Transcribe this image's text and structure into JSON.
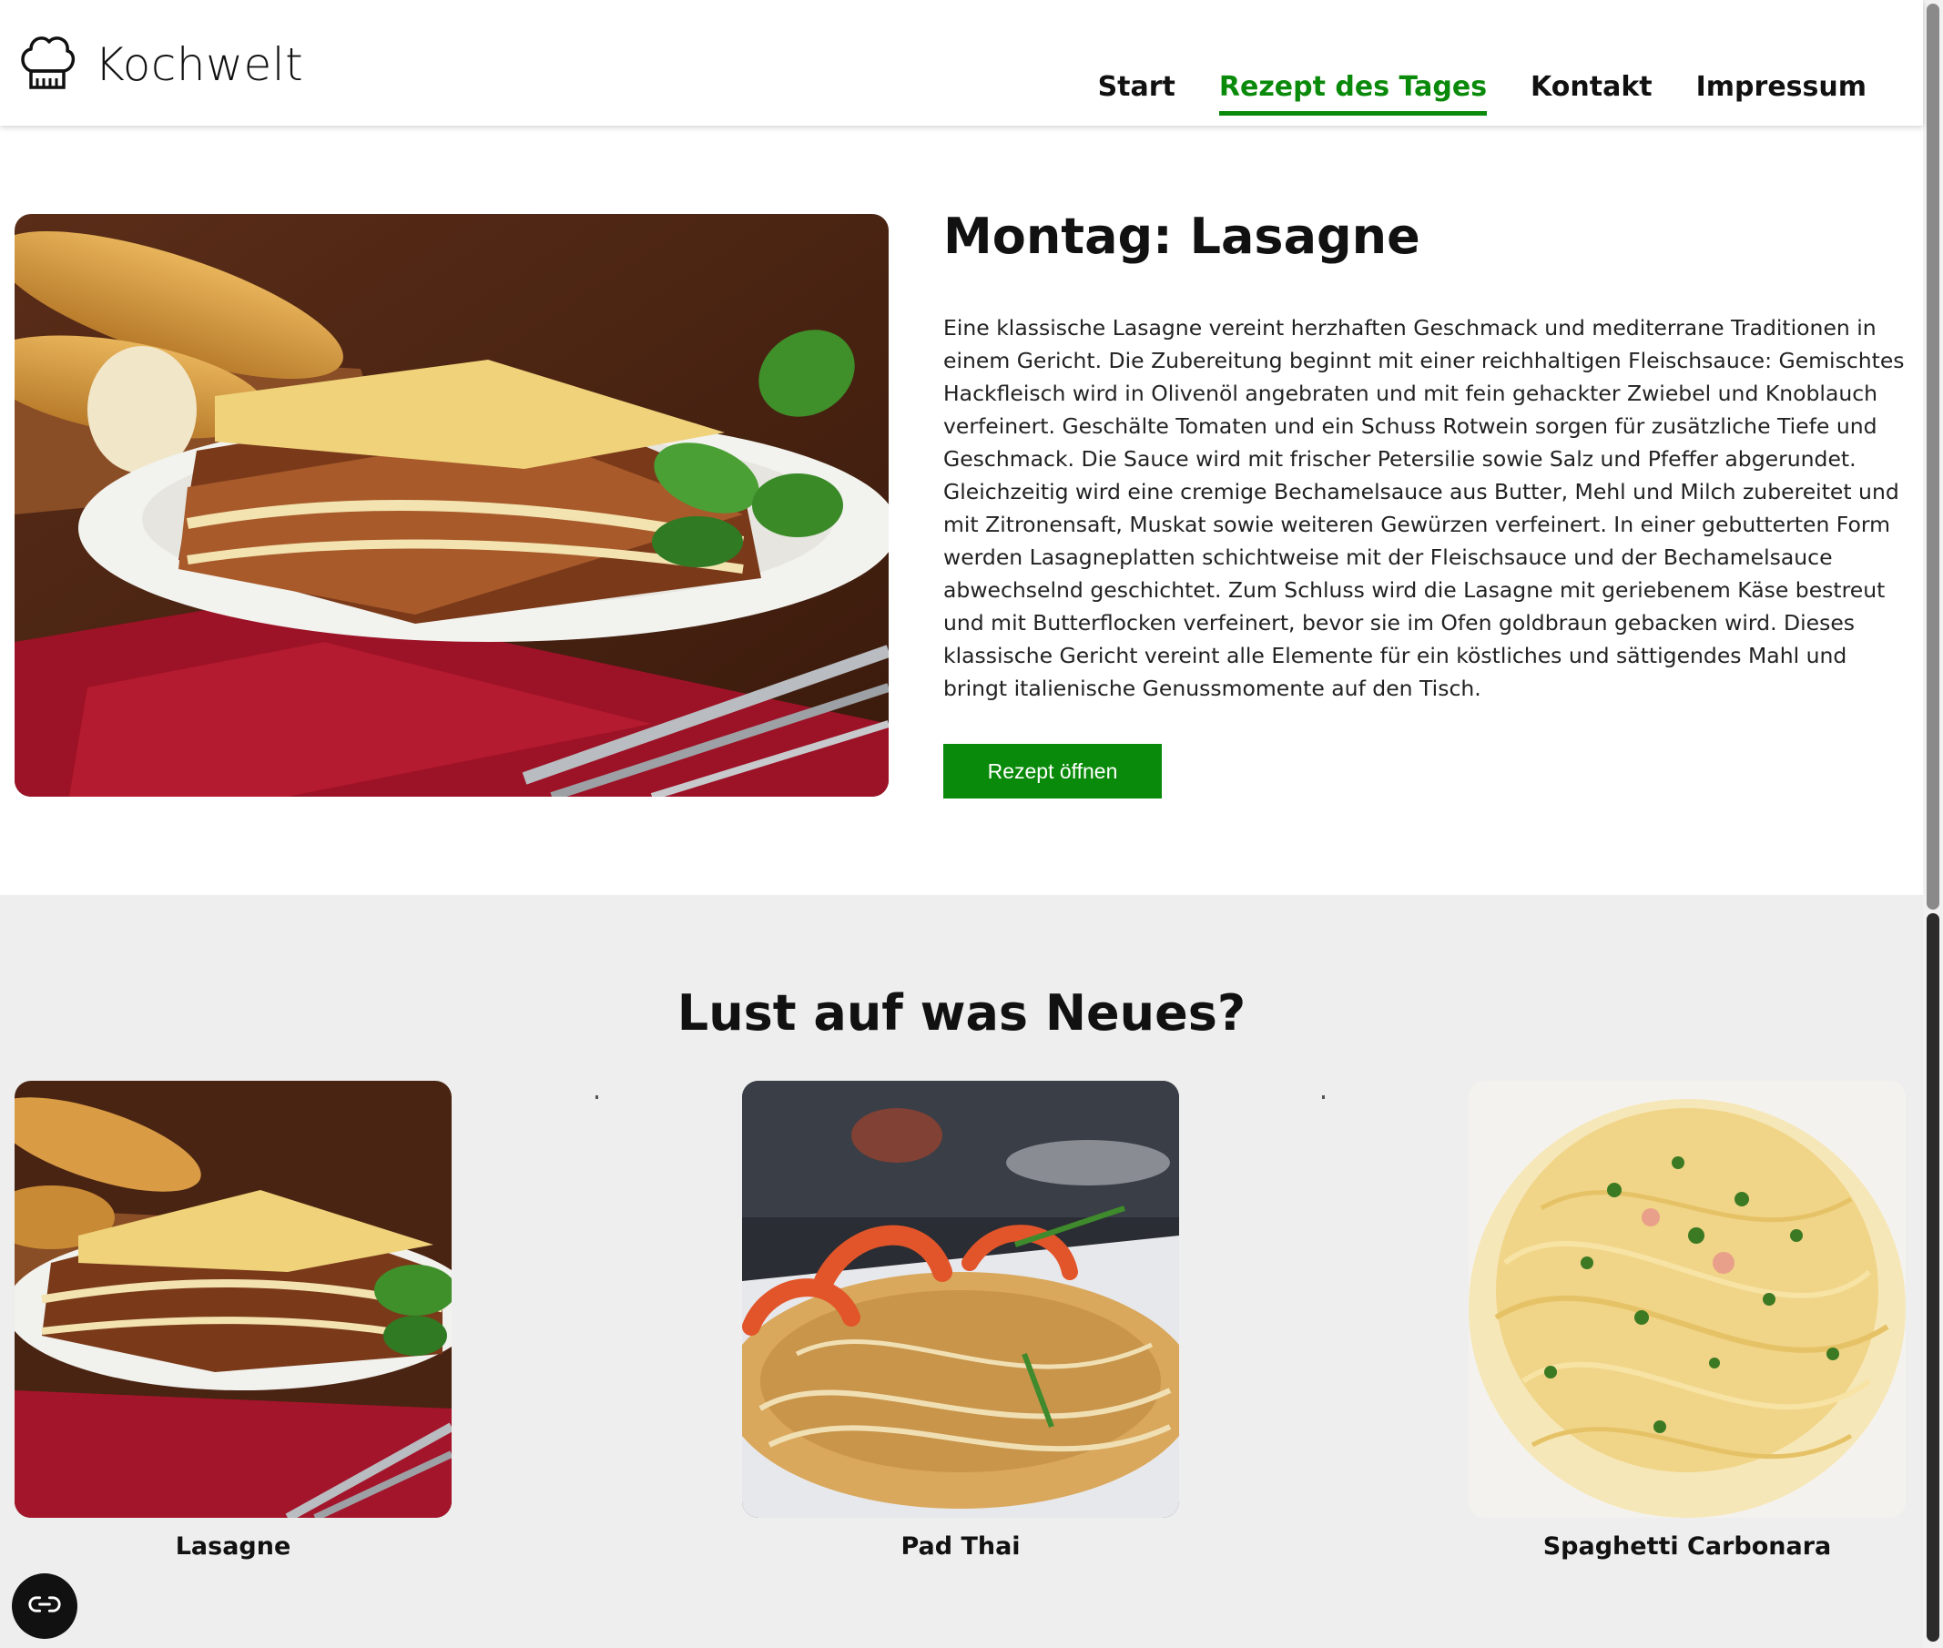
{
  "brand": {
    "name": "Kochwelt",
    "logo_icon": "chef-hat-icon"
  },
  "nav": {
    "items": [
      {
        "label": "Start",
        "active": false
      },
      {
        "label": "Rezept des Tages",
        "active": true
      },
      {
        "label": "Kontakt",
        "active": false
      },
      {
        "label": "Impressum",
        "active": false
      }
    ]
  },
  "hero": {
    "title": "Montag: Lasagne",
    "text": "Eine klassische Lasagne vereint herzhaften Geschmack und mediterrane Traditionen in einem Gericht. Die Zubereitung beginnt mit einer reichhaltigen Fleischsauce: Gemischtes Hackfleisch wird in Olivenöl angebraten und mit fein gehackter Zwiebel und Knoblauch verfeinert. Geschälte Tomaten und ein Schuss Rotwein sorgen für zusätzliche Tiefe und Geschmack. Die Sauce wird mit frischer Petersilie sowie Salz und Pfeffer abgerundet. Gleichzeitig wird eine cremige Bechamelsauce aus Butter, Mehl und Milch zubereitet und mit Zitronensaft, Muskat sowie weiteren Gewürzen verfeinert. In einer gebutterten Form werden Lasagneplatten schichtweise mit der Fleischsauce und der Bechamelsauce abwechselnd geschichtet. Zum Schluss wird die Lasagne mit geriebenem Käse bestreut und mit Butterflocken verfeinert, bevor sie im Ofen goldbraun gebacken wird. Dieses klassische Gericht vereint alle Elemente für ein köstliches und sättigendes Mahl und bringt italienische Genussmomente auf den Tisch.",
    "button_label": "Rezept öffnen"
  },
  "suggestions": {
    "title": "Lust auf was Neues?",
    "cards": [
      {
        "title": "Lasagne"
      },
      {
        "title": "Pad Thai"
      },
      {
        "title": "Spaghetti Carbonara"
      }
    ]
  },
  "colors": {
    "accent": "#0a8a0a",
    "section_bg": "#eeeeee"
  },
  "floating_button": {
    "icon": "accessibility-link-icon"
  }
}
